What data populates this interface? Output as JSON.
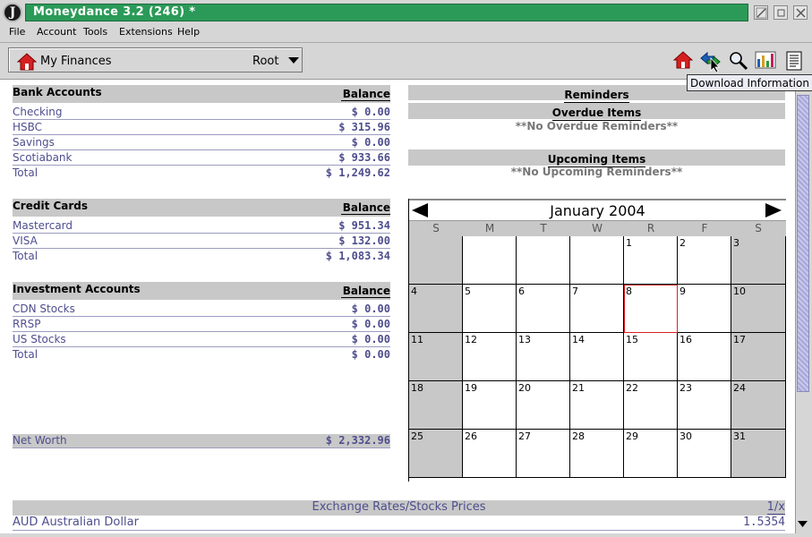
{
  "window": {
    "title": "Moneydance 3.2 (246) *",
    "logo": "J"
  },
  "menu": [
    "File",
    "Account",
    "Tools",
    "Extensions",
    "Help"
  ],
  "toolbar": {
    "account_name": "My Finances",
    "account_root": "Root",
    "icons": [
      "home-icon",
      "download-icon",
      "search-icon",
      "graph-icon",
      "report-icon"
    ]
  },
  "tooltip": "Download Information",
  "bank": {
    "title": "Bank Accounts",
    "balance_label": "Balance",
    "rows": [
      {
        "name": "Checking",
        "value": "$ 0.00"
      },
      {
        "name": "HSBC",
        "value": "$ 315.96"
      },
      {
        "name": "Savings",
        "value": "$ 0.00"
      },
      {
        "name": "Scotiabank",
        "value": "$ 933.66"
      }
    ],
    "total_label": "Total",
    "total": "$ 1,249.62"
  },
  "credit": {
    "title": "Credit Cards",
    "balance_label": "Balance",
    "rows": [
      {
        "name": "Mastercard",
        "value": "$ 951.34"
      },
      {
        "name": "VISA",
        "value": "$ 132.00"
      }
    ],
    "total_label": "Total",
    "total": "$ 1,083.34"
  },
  "invest": {
    "title": "Investment Accounts",
    "balance_label": "Balance",
    "rows": [
      {
        "name": "CDN Stocks",
        "value": "$ 0.00"
      },
      {
        "name": "RRSP",
        "value": "$ 0.00"
      },
      {
        "name": "US Stocks",
        "value": "$ 0.00"
      }
    ],
    "total_label": "Total",
    "total": "$ 0.00"
  },
  "networth": {
    "label": "Net Worth",
    "value": "$ 2,332.96"
  },
  "reminders": {
    "title": "Reminders",
    "overdue_title": "Overdue Items",
    "overdue_empty": "**No Overdue Reminders**",
    "upcoming_title": "Upcoming Items",
    "upcoming_empty": "**No Upcoming Reminders**"
  },
  "calendar": {
    "title": "January 2004",
    "days_of_week": [
      "S",
      "M",
      "T",
      "W",
      "R",
      "F",
      "S"
    ],
    "first_weekday": 4,
    "days_in_month": 31,
    "today": 8
  },
  "exchange": {
    "title": "Exchange Rates/Stocks Prices",
    "inverse_label": "1/x",
    "rows": [
      {
        "name": "AUD Australian Dollar",
        "value": "1.5354"
      }
    ]
  },
  "colors": {
    "title_bar": "#2b9a58",
    "link_text": "#4e4e8e",
    "header_bg": "#c8c8c8",
    "today_outline": "#e02020"
  }
}
